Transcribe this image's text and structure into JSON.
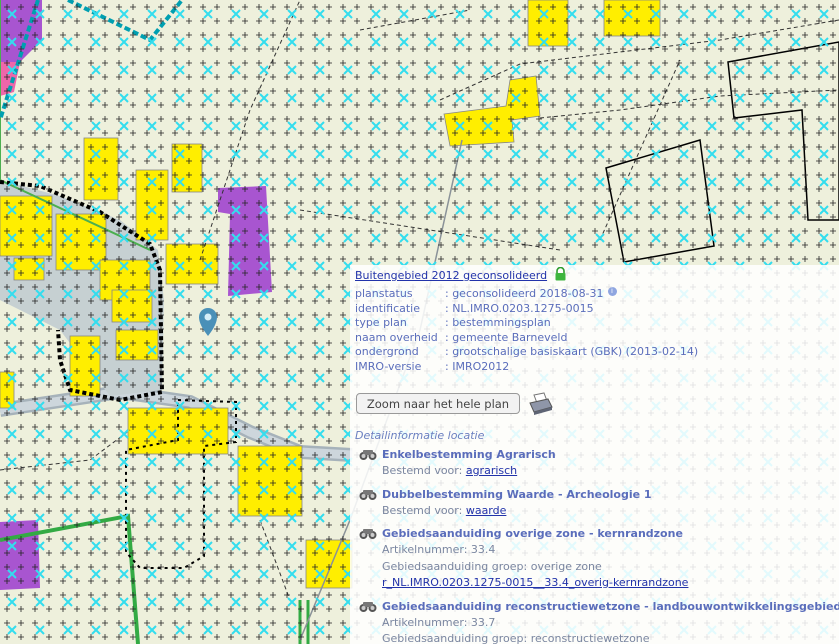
{
  "plan": {
    "title": "Buitengebied 2012 geconsolideerd",
    "meta": [
      {
        "key": "planstatus",
        "value": "geconsolideerd 2018-08-31"
      },
      {
        "key": "identificatie",
        "value": "NL.IMRO.0203.1275-0015"
      },
      {
        "key": "type plan",
        "value": "bestemmingsplan"
      },
      {
        "key": "naam overheid",
        "value": "gemeente Barneveld"
      },
      {
        "key": "ondergrond",
        "value": "grootschalige basiskaart (GBK) (2013-02-14)"
      },
      {
        "key": "IMRO-versie",
        "value": "IMRO2012"
      }
    ],
    "zoom_button": "Zoom naar het hele plan"
  },
  "detail_section": {
    "title": "Detailinformatie locatie",
    "items": [
      {
        "title": "Enkelbestemming Agrarisch",
        "lines": [
          {
            "label": "Bestemd voor: ",
            "link": "agrarisch"
          }
        ]
      },
      {
        "title": "Dubbelbestemming Waarde - Archeologie 1",
        "lines": [
          {
            "label": "Bestemd voor: ",
            "link": "waarde"
          }
        ]
      },
      {
        "title": "Gebiedsaanduiding overige zone - kernrandzone",
        "lines": [
          {
            "label": "Artikelnummer: 33.4",
            "link": ""
          },
          {
            "label": "Gebiedsaanduiding groep: overige zone",
            "link": ""
          },
          {
            "label": "",
            "link": "r_NL.IMRO.0203.1275-0015__33.4_overig-kernrandzone"
          }
        ]
      },
      {
        "title": "Gebiedsaanduiding reconstructiewetzone - landbouwontwikkelingsgebied",
        "lines": [
          {
            "label": "Artikelnummer: 33.7",
            "link": ""
          },
          {
            "label": "Gebiedsaanduiding groep: reconstructiewetzone",
            "link": ""
          }
        ]
      }
    ]
  },
  "map": {
    "colors": {
      "background": "#eef0dc",
      "building": "#ffee00",
      "purple_zone": "#a855d0",
      "road": "#b8c2c8",
      "cyan_marker": "#33ddee",
      "green_line": "#33aa44",
      "pink_zone": "#ee66aa"
    },
    "icons": [
      "location-pin-icon",
      "lock-icon",
      "info-icon",
      "print-icon",
      "binoculars-icon"
    ]
  }
}
